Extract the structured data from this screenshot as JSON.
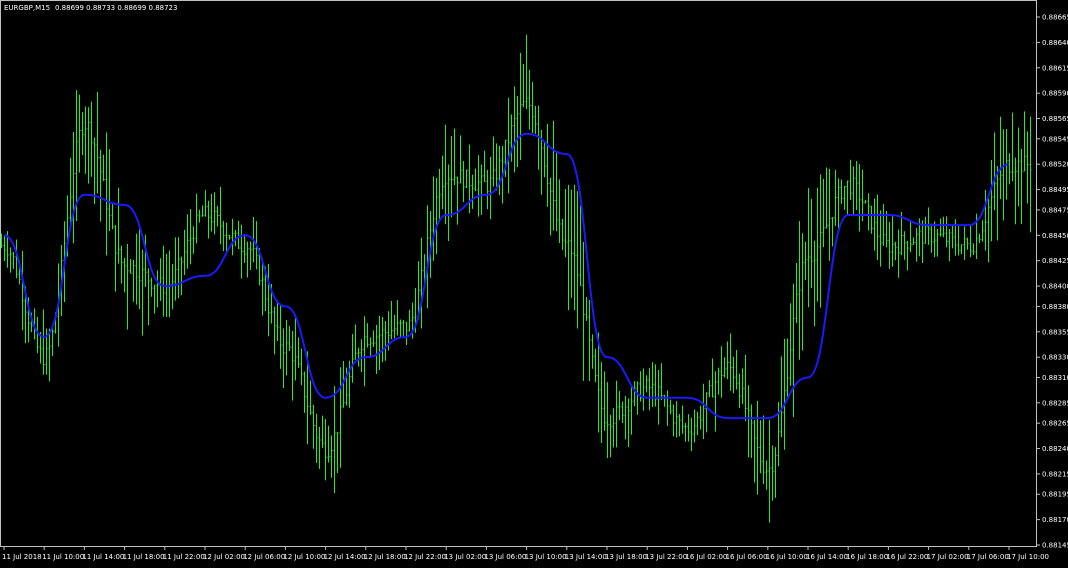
{
  "header": {
    "symbol": "EURGBP,M15",
    "ohlc": "0.88699 0.88733 0.88699 0.88723"
  },
  "colors": {
    "background": "#000000",
    "frame": "#c0c0c0",
    "bars": "#22ee22",
    "moving_average": "#1a1aff",
    "text": "#ffffff"
  },
  "chart_data": {
    "type": "line",
    "title": "EURGBP,M15",
    "xlabel": "",
    "ylabel": "",
    "ylim": [
      0.88137,
      0.88682
    ],
    "grid": false,
    "y_ticks": [
      "0.88665",
      "0.88640",
      "0.88615",
      "0.88590",
      "0.88565",
      "0.88545",
      "0.88520",
      "0.88495",
      "0.88475",
      "0.88450",
      "0.88425",
      "0.88400",
      "0.88380",
      "0.88355",
      "0.88330",
      "0.88310",
      "0.88285",
      "0.88265",
      "0.88240",
      "0.88215",
      "0.88195",
      "0.88170",
      "0.88145"
    ],
    "x_ticks": [
      "11 Jul 2018",
      "11 Jul 10:00",
      "11 Jul 14:00",
      "11 Jul 18:00",
      "11 Jul 22:00",
      "12 Jul 02:00",
      "12 Jul 06:00",
      "12 Jul 10:00",
      "12 Jul 14:00",
      "12 Jul 18:00",
      "12 Jul 22:00",
      "13 Jul 02:00",
      "13 Jul 06:00",
      "13 Jul 10:00",
      "13 Jul 14:00",
      "13 Jul 18:00",
      "13 Jul 22:00",
      "16 Jul 02:00",
      "16 Jul 06:00",
      "16 Jul 10:00",
      "16 Jul 14:00",
      "16 Jul 18:00",
      "16 Jul 22:00",
      "17 Jul 02:00",
      "17 Jul 06:00",
      "17 Jul 10:00"
    ],
    "series": [
      {
        "style": "bars",
        "color": "#22ee22",
        "x": [
          "11 Jul 2018",
          "11 Jul 10:00",
          "11 Jul 14:00",
          "11 Jul 18:00",
          "11 Jul 22:00",
          "12 Jul 02:00",
          "12 Jul 06:00",
          "12 Jul 10:00",
          "12 Jul 14:00",
          "12 Jul 18:00",
          "12 Jul 22:00",
          "13 Jul 02:00",
          "13 Jul 06:00",
          "13 Jul 10:00",
          "13 Jul 14:00",
          "13 Jul 18:00",
          "13 Jul 22:00",
          "16 Jul 02:00",
          "16 Jul 06:00",
          "16 Jul 10:00",
          "16 Jul 14:00",
          "16 Jul 18:00",
          "16 Jul 22:00",
          "17 Jul 02:00",
          "17 Jul 06:00",
          "17 Jul 10:00"
        ],
        "close": [
          0.8844,
          0.8833,
          0.8856,
          0.8842,
          0.884,
          0.8847,
          0.8844,
          0.8834,
          0.8824,
          0.8835,
          0.8836,
          0.8851,
          0.885,
          0.8858,
          0.8844,
          0.8827,
          0.883,
          0.8826,
          0.8832,
          0.8822,
          0.8843,
          0.885,
          0.8844,
          0.8845,
          0.8844,
          0.8852
        ],
        "high": [
          0.8847,
          0.884,
          0.8861,
          0.8854,
          0.8845,
          0.885,
          0.8849,
          0.8842,
          0.8834,
          0.884,
          0.8841,
          0.8854,
          0.8856,
          0.8865,
          0.8858,
          0.8837,
          0.8833,
          0.8829,
          0.8836,
          0.883,
          0.8852,
          0.8853,
          0.8849,
          0.8848,
          0.8847,
          0.8864
        ],
        "low": [
          0.8841,
          0.8828,
          0.8845,
          0.8833,
          0.8835,
          0.8841,
          0.884,
          0.883,
          0.882,
          0.8829,
          0.8832,
          0.8837,
          0.8846,
          0.8847,
          0.8836,
          0.8823,
          0.8825,
          0.8824,
          0.8824,
          0.8815,
          0.883,
          0.8844,
          0.884,
          0.8842,
          0.8841,
          0.8845
        ]
      },
      {
        "style": "line",
        "color": "#1a1aff",
        "x": [
          "11 Jul 2018",
          "11 Jul 10:00",
          "11 Jul 14:00",
          "11 Jul 18:00",
          "11 Jul 22:00",
          "12 Jul 02:00",
          "12 Jul 06:00",
          "12 Jul 10:00",
          "12 Jul 14:00",
          "12 Jul 18:00",
          "12 Jul 22:00",
          "13 Jul 02:00",
          "13 Jul 06:00",
          "13 Jul 10:00",
          "13 Jul 14:00",
          "13 Jul 18:00",
          "13 Jul 22:00",
          "16 Jul 02:00",
          "16 Jul 06:00",
          "16 Jul 10:00",
          "16 Jul 14:00",
          "16 Jul 18:00",
          "16 Jul 22:00",
          "17 Jul 02:00",
          "17 Jul 06:00",
          "17 Jul 10:00"
        ],
        "values": [
          0.8845,
          0.8835,
          0.8849,
          0.8848,
          0.884,
          0.8841,
          0.8845,
          0.8838,
          0.8829,
          0.8833,
          0.8835,
          0.8847,
          0.8849,
          0.8855,
          0.8853,
          0.8833,
          0.8829,
          0.8829,
          0.8827,
          0.8827,
          0.8831,
          0.8847,
          0.8847,
          0.8846,
          0.8846,
          0.8852
        ]
      }
    ]
  }
}
